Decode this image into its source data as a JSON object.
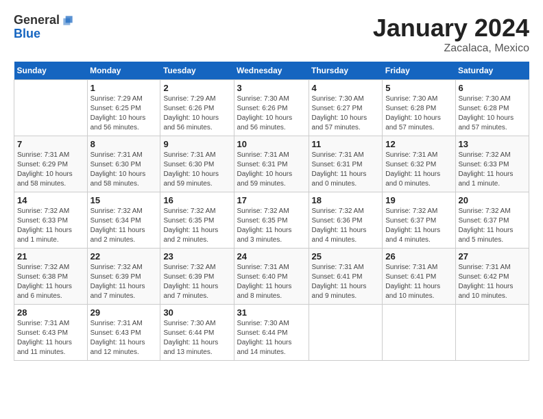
{
  "header": {
    "logo_general": "General",
    "logo_blue": "Blue",
    "month_title": "January 2024",
    "location": "Zacalaca, Mexico"
  },
  "columns": [
    "Sunday",
    "Monday",
    "Tuesday",
    "Wednesday",
    "Thursday",
    "Friday",
    "Saturday"
  ],
  "weeks": [
    [
      {
        "day": "",
        "info": ""
      },
      {
        "day": "1",
        "info": "Sunrise: 7:29 AM\nSunset: 6:25 PM\nDaylight: 10 hours\nand 56 minutes."
      },
      {
        "day": "2",
        "info": "Sunrise: 7:29 AM\nSunset: 6:26 PM\nDaylight: 10 hours\nand 56 minutes."
      },
      {
        "day": "3",
        "info": "Sunrise: 7:30 AM\nSunset: 6:26 PM\nDaylight: 10 hours\nand 56 minutes."
      },
      {
        "day": "4",
        "info": "Sunrise: 7:30 AM\nSunset: 6:27 PM\nDaylight: 10 hours\nand 57 minutes."
      },
      {
        "day": "5",
        "info": "Sunrise: 7:30 AM\nSunset: 6:28 PM\nDaylight: 10 hours\nand 57 minutes."
      },
      {
        "day": "6",
        "info": "Sunrise: 7:30 AM\nSunset: 6:28 PM\nDaylight: 10 hours\nand 57 minutes."
      }
    ],
    [
      {
        "day": "7",
        "info": "Sunrise: 7:31 AM\nSunset: 6:29 PM\nDaylight: 10 hours\nand 58 minutes."
      },
      {
        "day": "8",
        "info": "Sunrise: 7:31 AM\nSunset: 6:30 PM\nDaylight: 10 hours\nand 58 minutes."
      },
      {
        "day": "9",
        "info": "Sunrise: 7:31 AM\nSunset: 6:30 PM\nDaylight: 10 hours\nand 59 minutes."
      },
      {
        "day": "10",
        "info": "Sunrise: 7:31 AM\nSunset: 6:31 PM\nDaylight: 10 hours\nand 59 minutes."
      },
      {
        "day": "11",
        "info": "Sunrise: 7:31 AM\nSunset: 6:31 PM\nDaylight: 11 hours\nand 0 minutes."
      },
      {
        "day": "12",
        "info": "Sunrise: 7:31 AM\nSunset: 6:32 PM\nDaylight: 11 hours\nand 0 minutes."
      },
      {
        "day": "13",
        "info": "Sunrise: 7:32 AM\nSunset: 6:33 PM\nDaylight: 11 hours\nand 1 minute."
      }
    ],
    [
      {
        "day": "14",
        "info": "Sunrise: 7:32 AM\nSunset: 6:33 PM\nDaylight: 11 hours\nand 1 minute."
      },
      {
        "day": "15",
        "info": "Sunrise: 7:32 AM\nSunset: 6:34 PM\nDaylight: 11 hours\nand 2 minutes."
      },
      {
        "day": "16",
        "info": "Sunrise: 7:32 AM\nSunset: 6:35 PM\nDaylight: 11 hours\nand 2 minutes."
      },
      {
        "day": "17",
        "info": "Sunrise: 7:32 AM\nSunset: 6:35 PM\nDaylight: 11 hours\nand 3 minutes."
      },
      {
        "day": "18",
        "info": "Sunrise: 7:32 AM\nSunset: 6:36 PM\nDaylight: 11 hours\nand 4 minutes."
      },
      {
        "day": "19",
        "info": "Sunrise: 7:32 AM\nSunset: 6:37 PM\nDaylight: 11 hours\nand 4 minutes."
      },
      {
        "day": "20",
        "info": "Sunrise: 7:32 AM\nSunset: 6:37 PM\nDaylight: 11 hours\nand 5 minutes."
      }
    ],
    [
      {
        "day": "21",
        "info": "Sunrise: 7:32 AM\nSunset: 6:38 PM\nDaylight: 11 hours\nand 6 minutes."
      },
      {
        "day": "22",
        "info": "Sunrise: 7:32 AM\nSunset: 6:39 PM\nDaylight: 11 hours\nand 7 minutes."
      },
      {
        "day": "23",
        "info": "Sunrise: 7:32 AM\nSunset: 6:39 PM\nDaylight: 11 hours\nand 7 minutes."
      },
      {
        "day": "24",
        "info": "Sunrise: 7:31 AM\nSunset: 6:40 PM\nDaylight: 11 hours\nand 8 minutes."
      },
      {
        "day": "25",
        "info": "Sunrise: 7:31 AM\nSunset: 6:41 PM\nDaylight: 11 hours\nand 9 minutes."
      },
      {
        "day": "26",
        "info": "Sunrise: 7:31 AM\nSunset: 6:41 PM\nDaylight: 11 hours\nand 10 minutes."
      },
      {
        "day": "27",
        "info": "Sunrise: 7:31 AM\nSunset: 6:42 PM\nDaylight: 11 hours\nand 10 minutes."
      }
    ],
    [
      {
        "day": "28",
        "info": "Sunrise: 7:31 AM\nSunset: 6:43 PM\nDaylight: 11 hours\nand 11 minutes."
      },
      {
        "day": "29",
        "info": "Sunrise: 7:31 AM\nSunset: 6:43 PM\nDaylight: 11 hours\nand 12 minutes."
      },
      {
        "day": "30",
        "info": "Sunrise: 7:30 AM\nSunset: 6:44 PM\nDaylight: 11 hours\nand 13 minutes."
      },
      {
        "day": "31",
        "info": "Sunrise: 7:30 AM\nSunset: 6:44 PM\nDaylight: 11 hours\nand 14 minutes."
      },
      {
        "day": "",
        "info": ""
      },
      {
        "day": "",
        "info": ""
      },
      {
        "day": "",
        "info": ""
      }
    ]
  ]
}
